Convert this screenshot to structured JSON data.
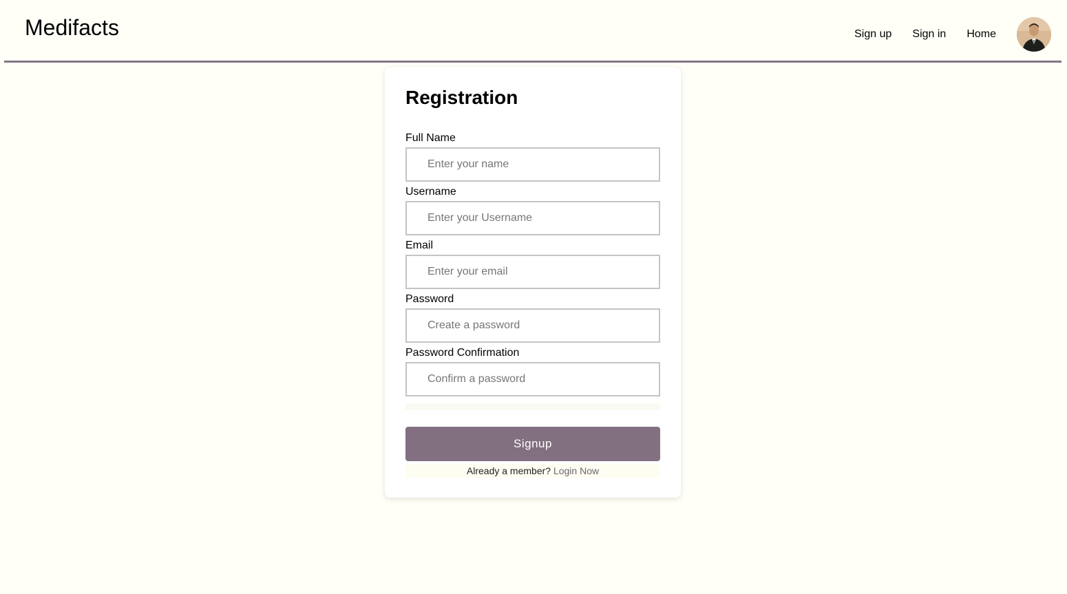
{
  "header": {
    "brand": "Medifacts",
    "nav": [
      {
        "label": "Sign up"
      },
      {
        "label": "Sign in"
      },
      {
        "label": "Home"
      }
    ]
  },
  "form": {
    "title": "Registration",
    "fields": [
      {
        "label": "Full Name",
        "placeholder": "Enter your name",
        "value": ""
      },
      {
        "label": "Username",
        "placeholder": "Enter your Username",
        "value": ""
      },
      {
        "label": "Email",
        "placeholder": "Enter your email",
        "value": ""
      },
      {
        "label": "Password",
        "placeholder": "Create a password",
        "value": ""
      },
      {
        "label": "Password Confirmation",
        "placeholder": "Confirm a password",
        "value": ""
      }
    ],
    "submit_label": "Signup",
    "member_prompt": "Already a member?",
    "login_link": "Login Now"
  },
  "colors": {
    "background": "#fffff7",
    "accent": "#827081",
    "header_border": "#837483"
  },
  "icons": {
    "avatar": "user-avatar-photo"
  }
}
